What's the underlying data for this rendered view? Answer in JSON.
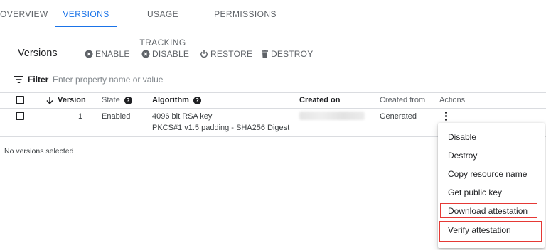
{
  "tabs": [
    {
      "label": "OVERVIEW",
      "active": false
    },
    {
      "label": "VERSIONS",
      "active": true
    },
    {
      "label": "USAGE TRACKING",
      "active": false
    },
    {
      "label": "PERMISSIONS",
      "active": false
    }
  ],
  "toolbar": {
    "title": "Versions",
    "enable_label": "ENABLE",
    "disable_label": "DISABLE",
    "restore_label": "RESTORE",
    "destroy_label": "DESTROY"
  },
  "filter": {
    "label": "Filter",
    "placeholder": "Enter property name or value"
  },
  "table": {
    "headers": {
      "version": "Version",
      "state": "State",
      "algorithm": "Algorithm",
      "created_on": "Created on",
      "created_from": "Created from",
      "actions": "Actions"
    },
    "rows": [
      {
        "version": "1",
        "state": "Enabled",
        "algorithm_line1": "4096 bit RSA key",
        "algorithm_line2": "PKCS#1 v1.5 padding - SHA256 Digest",
        "created_from": "Generated"
      }
    ]
  },
  "status": "No versions selected",
  "menu": {
    "items": [
      "Disable",
      "Destroy",
      "Copy resource name",
      "Get public key",
      "Download attestation",
      "Verify attestation"
    ]
  },
  "colors": {
    "accent": "#1a73e8",
    "highlight": "#e53935"
  }
}
